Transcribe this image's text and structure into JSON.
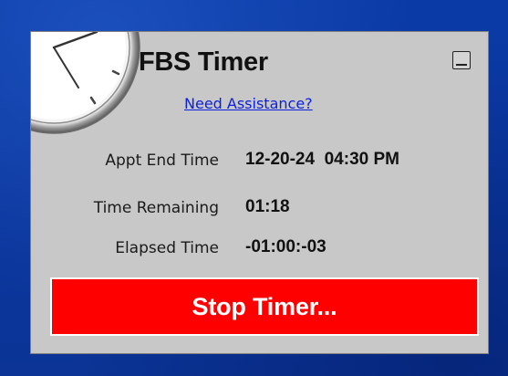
{
  "window": {
    "title": "FBS Timer",
    "help_link": "Need Assistance?",
    "minimize_icon": "minimize-icon",
    "clock_icon": "clock-icon"
  },
  "rows": [
    {
      "label": "Appt End Time",
      "value": "12-20-24  04:30 PM"
    },
    {
      "label": "Time Remaining",
      "value": "01:18"
    },
    {
      "label": "Elapsed Time",
      "value": "-01:00:-03"
    }
  ],
  "stop_button": {
    "label": "Stop Timer..."
  },
  "colors": {
    "background": "#0a3aa6",
    "panel": "#c8c8c8",
    "stop_button": "#ff0000",
    "link": "#0b1fe0"
  }
}
